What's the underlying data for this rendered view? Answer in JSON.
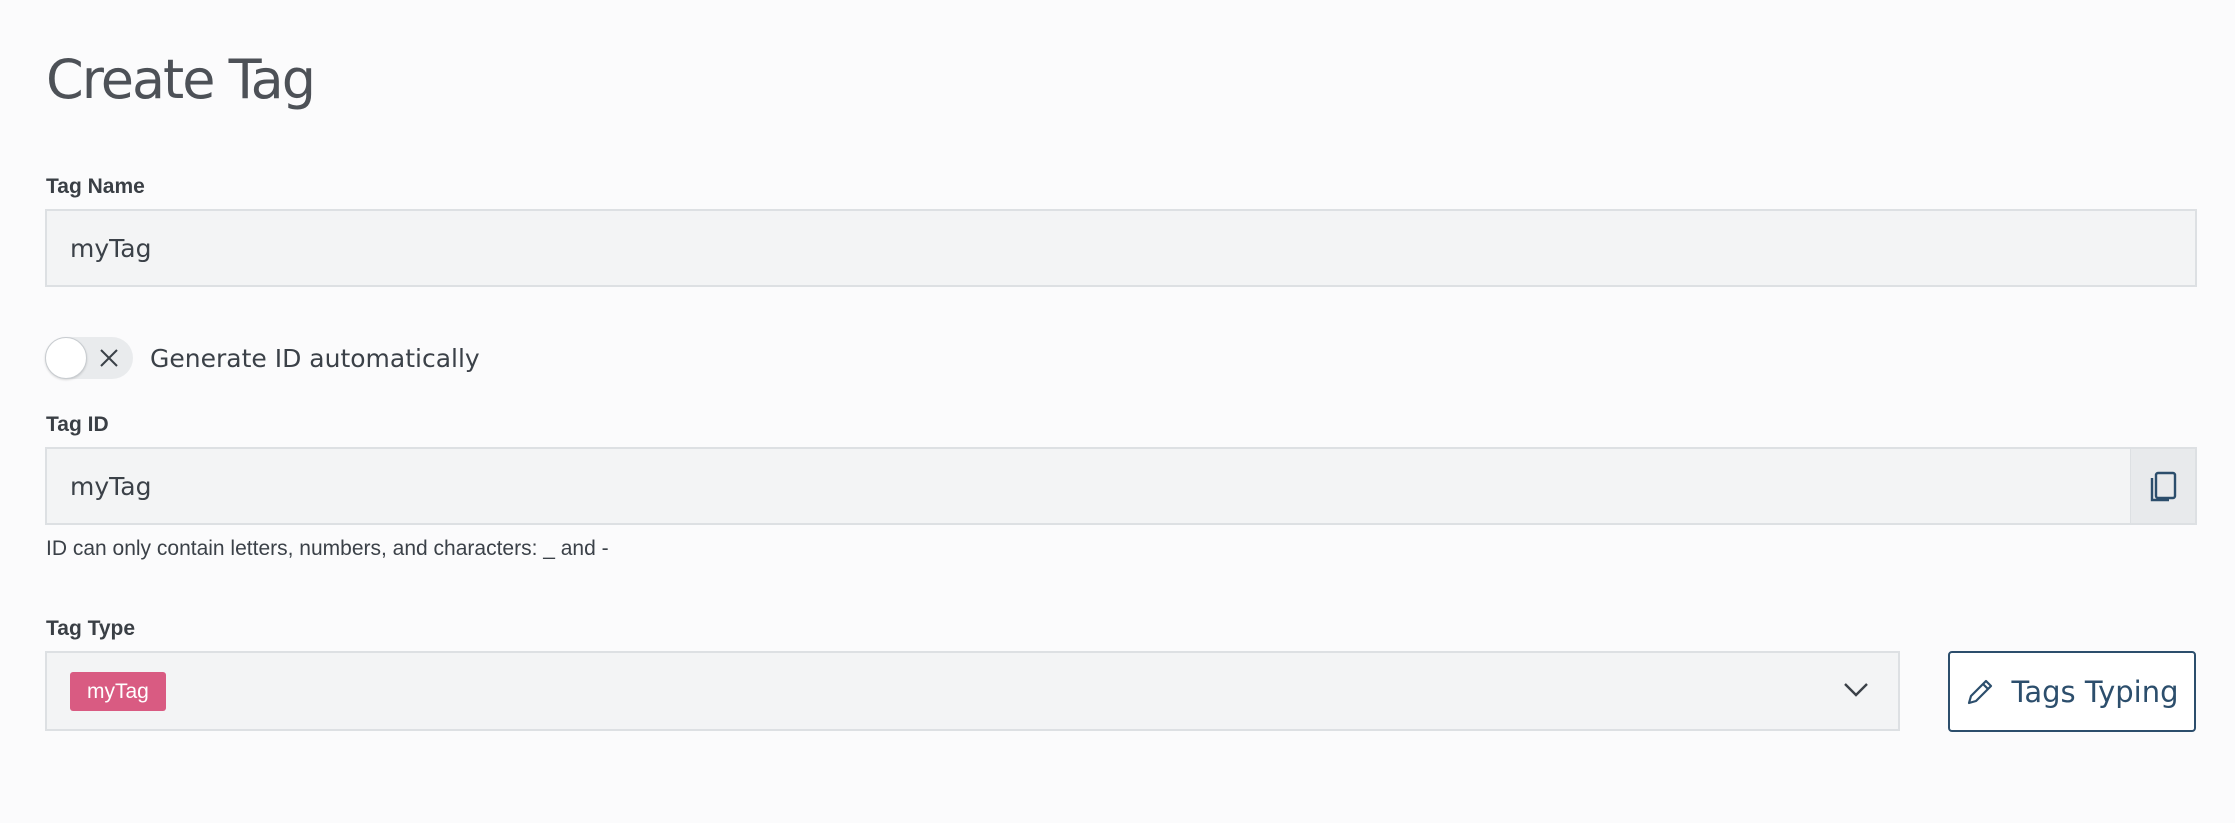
{
  "page": {
    "title": "Create Tag"
  },
  "tag_name": {
    "label": "Tag Name",
    "value": "myTag"
  },
  "auto_id": {
    "label": "Generate ID automatically",
    "enabled": false
  },
  "tag_id": {
    "label": "Tag ID",
    "value": "myTag",
    "help": "ID can only contain letters, numbers, and characters: _ and -"
  },
  "tag_type": {
    "label": "Tag Type",
    "selected": "myTag",
    "chip_color": "#d95b82"
  },
  "actions": {
    "tags_typing_label": "Tags Typing"
  },
  "icons": {
    "copy": "copy-icon",
    "toggle_off": "close-icon",
    "dropdown": "chevron-down-icon",
    "edit": "pencil-icon"
  },
  "colors": {
    "accent": "#2c4e6c",
    "field_bg": "#f3f4f5",
    "field_border": "#dde0e3"
  }
}
